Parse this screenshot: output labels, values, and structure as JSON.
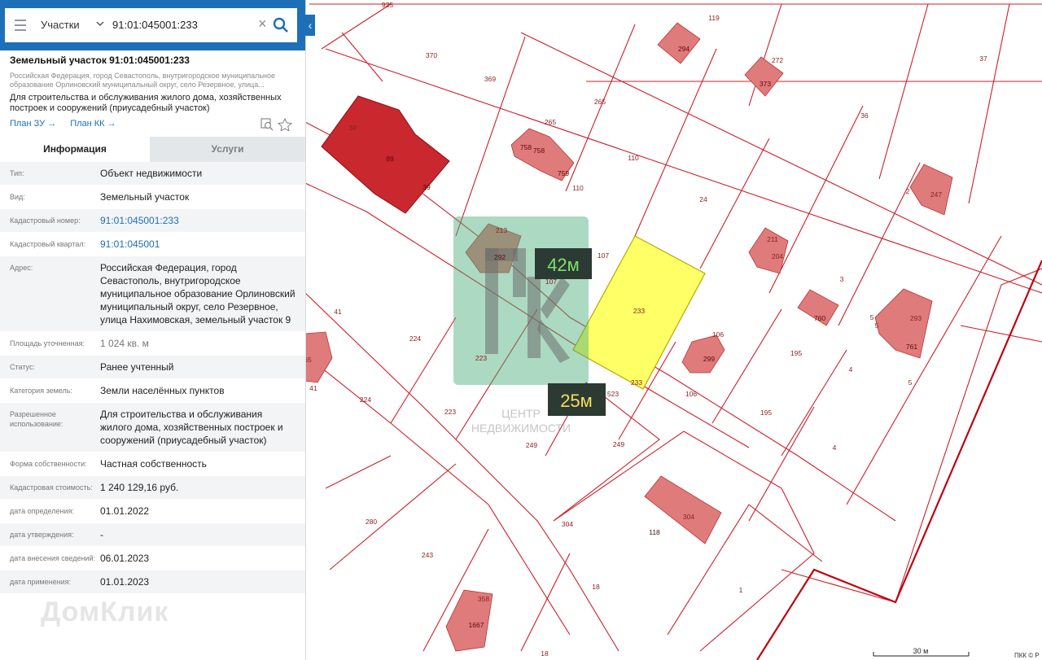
{
  "search": {
    "type_label": "Участки",
    "value": "91:01:045001:233"
  },
  "header": {
    "title": "Земельный участок 91:01:045001:233",
    "address_short": "Российская Федерация, город Севастополь, внутригородское муниципальное образование Орлиновский муниципальный округ, село Резервное, улица...",
    "purpose_short": "Для строительства и обслуживания жилого дома, хозяйственных построек и сооружений (приусадебный участок)",
    "link_plan_zu": "План ЗУ →",
    "link_plan_kk": "План КК →"
  },
  "tabs": {
    "info": "Информация",
    "services": "Услуги"
  },
  "info": [
    {
      "label": "Тип:",
      "value": "Объект недвижимости"
    },
    {
      "label": "Вид:",
      "value": "Земельный участок"
    },
    {
      "label": "Кадастровый номер:",
      "value": "91:01:045001:233",
      "link": true
    },
    {
      "label": "Кадастровый квартал:",
      "value": "91:01:045001",
      "link": true
    },
    {
      "label": "Адрес:",
      "value": "Российская Федерация, город Севастополь, внутригородское муниципальное образование Орлиновский муниципальный округ, село Резервное, улица Нахимовская, земельный участок 9"
    },
    {
      "label": "Площадь уточненная:",
      "value": "1 024 кв. м",
      "grey": true
    },
    {
      "label": "Статус:",
      "value": "Ранее учтенный"
    },
    {
      "label": "Категория земель:",
      "value": "Земли населённых пунктов"
    },
    {
      "label": "Разрешенное использование:",
      "value": "Для строительства и обслуживания жилого дома, хозяйственных построек и сооружений (приусадебный участок)"
    },
    {
      "label": "Форма собственности:",
      "value": "Частная собственность"
    },
    {
      "label": "Кадастровая стоимость:",
      "value": "1 240 129,16 руб."
    },
    {
      "label": "дата определения:",
      "value": "01.01.2022"
    },
    {
      "label": "дата утверждения:",
      "value": "-"
    },
    {
      "label": "дата внесения сведений:",
      "value": "06.01.2023"
    },
    {
      "label": "дата применения:",
      "value": "01.01.2023"
    }
  ],
  "watermark_domclick": "ДомКлик",
  "map": {
    "measure_long": "42м",
    "measure_short": "25м",
    "watermark_agency": [
      "ЦЕНТР",
      "НЕДВИЖИМОСТИ"
    ],
    "scale_label": "30 м",
    "attribution": "ПКК © Р",
    "parcel_labels": [
      "925",
      "119",
      "370",
      "294",
      "272",
      "37",
      "369",
      "373",
      "265",
      "36",
      "38",
      "265",
      "758",
      "758",
      "759",
      "89",
      "39",
      "110",
      "110",
      "24",
      "247",
      "213",
      "292",
      "107",
      "107",
      "211",
      "204",
      "3",
      "41",
      "224",
      "233",
      "106",
      "299",
      "760",
      "5",
      "293",
      "761",
      "195",
      "223",
      "223",
      "4",
      "5",
      "224",
      "523",
      "233",
      "106",
      "195",
      "249",
      "249",
      "4",
      "280",
      "304",
      "118",
      "304",
      "243",
      "18",
      "1",
      "358",
      "1667",
      "18",
      "65",
      "41",
      "2",
      "5"
    ],
    "accent_colors": {
      "selected_parcel": "#ffff66",
      "boundary": "#cc1f2a",
      "building": "#e07b7b",
      "highlight_building": "#c8282e",
      "measure_bg": "#2b3a33",
      "measure_text_long": "#7ee06b",
      "measure_text_short": "#f7df5a"
    }
  }
}
